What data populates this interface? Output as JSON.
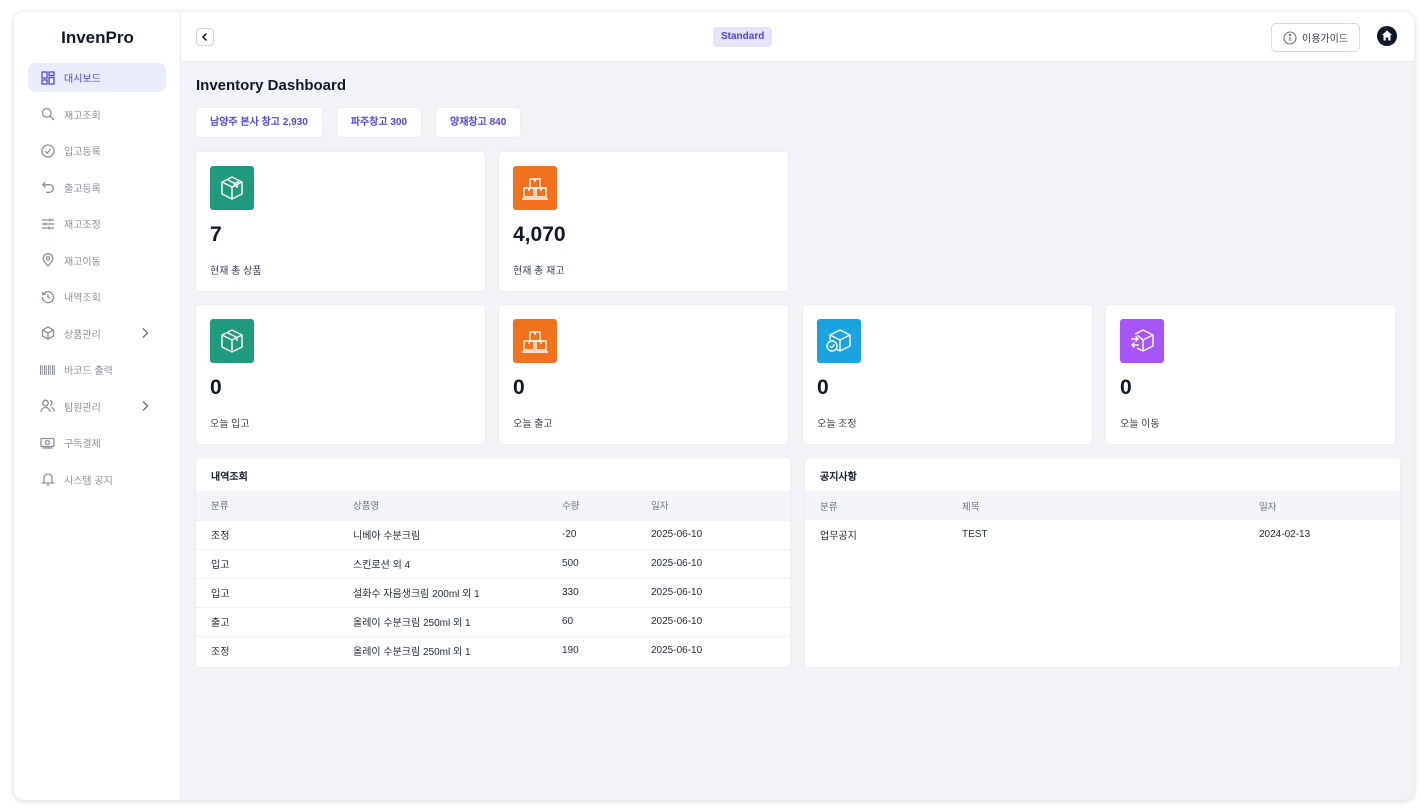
{
  "app": {
    "brand": "InvenPro"
  },
  "sidebar": {
    "items": [
      {
        "label": "대시보드",
        "icon": "dashboard-icon"
      },
      {
        "label": "재고조회",
        "icon": "search-icon"
      },
      {
        "label": "입고등록",
        "icon": "check-circle-icon"
      },
      {
        "label": "출고등록",
        "icon": "undo-arrow-icon"
      },
      {
        "label": "재고조정",
        "icon": "sliders-icon"
      },
      {
        "label": "재고이동",
        "icon": "location-pin-icon"
      },
      {
        "label": "내역조회",
        "icon": "history-icon"
      },
      {
        "label": "상품관리",
        "icon": "box-icon"
      },
      {
        "label": "바코드 출력",
        "icon": "barcode-icon"
      },
      {
        "label": "팀원관리",
        "icon": "users-icon"
      },
      {
        "label": "구독결제",
        "icon": "payment-icon"
      },
      {
        "label": "시스템 공지",
        "icon": "bell-icon"
      }
    ]
  },
  "topbar": {
    "plan": "Standard",
    "guide_label": "이용가이드"
  },
  "page": {
    "title": "Inventory Dashboard"
  },
  "warehouses": [
    "남양주 본사 창고 2,930",
    "파주창고 300",
    "양재창고 840"
  ],
  "stats": {
    "total_products": {
      "value": "7",
      "label": "현재 총 상품"
    },
    "total_stock": {
      "value": "4,070",
      "label": "현재 총 재고"
    },
    "today_in": {
      "value": "0",
      "label": "오늘 입고"
    },
    "today_out": {
      "value": "0",
      "label": "오늘 출고"
    },
    "today_adjust": {
      "value": "0",
      "label": "오늘 조정"
    },
    "today_move": {
      "value": "0",
      "label": "오늘 이동"
    }
  },
  "colors": {
    "green": "#1f9a7e",
    "orange": "#f2711c",
    "blue": "#1aa3e0",
    "purple": "#a855f7",
    "accent": "#4f46e5"
  },
  "history": {
    "title": "내역조회",
    "columns": [
      "분류",
      "상품명",
      "수량",
      "일자"
    ],
    "rows": [
      [
        "조정",
        "니베아 수분크림",
        "-20",
        "2025-06-10"
      ],
      [
        "입고",
        "스킨로션 외 4",
        "500",
        "2025-06-10"
      ],
      [
        "입고",
        "설화수 자음생크림 200ml 외 1",
        "330",
        "2025-06-10"
      ],
      [
        "출고",
        "올레이 수분크림 250ml 외 1",
        "60",
        "2025-06-10"
      ],
      [
        "조정",
        "올레이 수분크림 250ml 외 1",
        "190",
        "2025-06-10"
      ]
    ]
  },
  "notices": {
    "title": "공지사항",
    "columns": [
      "분류",
      "제목",
      "일자"
    ],
    "rows": [
      [
        "업무공지",
        "TEST",
        "2024-02-13"
      ]
    ]
  }
}
